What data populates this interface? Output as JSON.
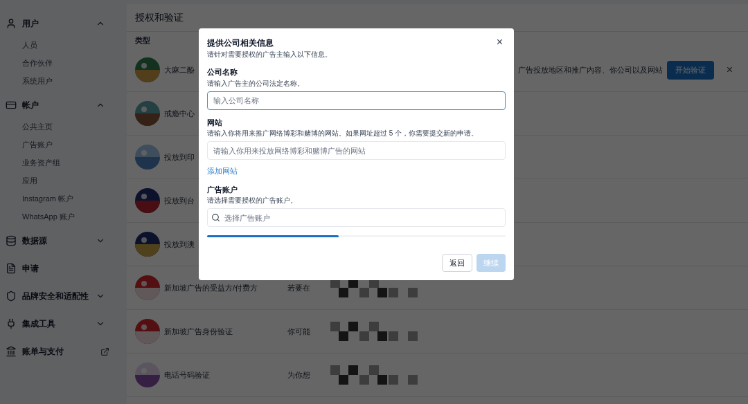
{
  "sidebar": {
    "groups": [
      {
        "label": "用户",
        "kind": "expandable",
        "expanded": true,
        "items": [
          "人员",
          "合作伙伴",
          "系统用户"
        ]
      },
      {
        "label": "帐户",
        "kind": "expandable",
        "expanded": true,
        "items": [
          "公共主页",
          "广告账户",
          "业务资产组",
          "应用",
          "Instagram 帐户",
          "WhatsApp 账户"
        ]
      },
      {
        "label": "数据源",
        "kind": "expandable",
        "expanded": false
      },
      {
        "label": "申请",
        "kind": "plain"
      },
      {
        "label": "品牌安全和适配性",
        "kind": "expandable",
        "expanded": false
      },
      {
        "label": "集成工具",
        "kind": "expandable",
        "expanded": false
      },
      {
        "label": "账单与支付",
        "kind": "link"
      }
    ]
  },
  "page": {
    "title": "授权和验证",
    "table": {
      "columns": [
        "类型"
      ],
      "banner": {
        "text": "广告投放地区和推广内容、你公司以及网站",
        "button": "开始验证",
        "close": "×"
      },
      "rows": [
        {
          "title": "大麻二酚"
        },
        {
          "title": "戒瘾中心"
        },
        {
          "title": "投放到印"
        },
        {
          "title": "投放到台"
        },
        {
          "title": "投放到澳"
        },
        {
          "title": "新加坡广告的受益方/付费方",
          "description": "若要在"
        },
        {
          "title": "新加坡广告身份验证",
          "description": "你可能"
        },
        {
          "title": "电话号码验证",
          "description": "为你想"
        }
      ]
    }
  },
  "dialog": {
    "title": "提供公司相关信息",
    "subtitle": "请针对需要授权的广告主输入以下信息。",
    "close": "×",
    "fields": [
      {
        "kind": "text",
        "label": "公司名称",
        "hint": "请输入广告主的公司法定名称。",
        "placeholder": "输入公司名称",
        "focused": true
      },
      {
        "kind": "text",
        "label": "网站",
        "hint": "请输入你将用来推广网络博彩和赌博的网站。如果网址超过 5 个，你需要提交新的申请。",
        "placeholder": "请输入你用来投放网络博彩和赌博广告的网站",
        "focused": false,
        "link": "添加网站"
      },
      {
        "kind": "search",
        "label": "广告账户",
        "hint": "请选择需要授权的广告账户。",
        "placeholder": "选择广告账户",
        "focused": false
      }
    ],
    "progress": {
      "level": 0.44
    },
    "buttons": [
      {
        "label": "返回",
        "kind": "secondary",
        "disabled": false
      },
      {
        "label": "继续",
        "kind": "primary",
        "disabled": true
      }
    ]
  }
}
